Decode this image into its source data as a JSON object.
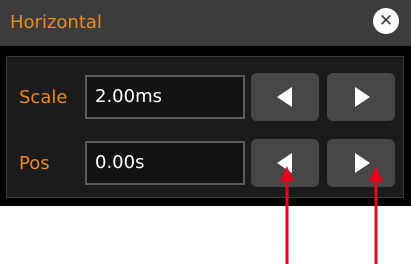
{
  "dialog": {
    "title": "Horizontal",
    "close_glyph": "✕"
  },
  "rows": [
    {
      "label": "Scale",
      "value": "2.00ms"
    },
    {
      "label": "Pos",
      "value": "0.00s"
    }
  ],
  "buttons": {
    "decrease_icon": "left-triangle-icon",
    "increase_icon": "right-triangle-icon"
  },
  "colors": {
    "accent": "#e88b1e",
    "title_bar": "#3c3c3c",
    "button": "#474747",
    "annotation_arrow": "#e8001c"
  }
}
